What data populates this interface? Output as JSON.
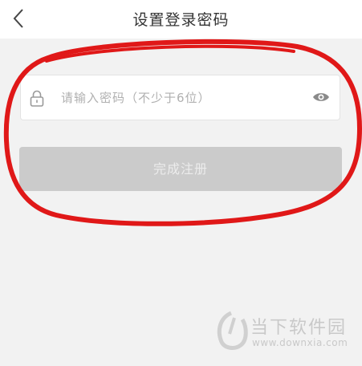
{
  "header": {
    "title": "设置登录密码"
  },
  "password_field": {
    "placeholder": "请输入密码（不少于6位）",
    "value": ""
  },
  "submit_button": {
    "label": "完成注册"
  },
  "watermark": {
    "name": "当下软件园",
    "url": "www.downxia.com"
  },
  "colors": {
    "annotation_circle": "#e01818",
    "button_disabled": "#cbcbcb",
    "background": "#f2f2f2"
  }
}
